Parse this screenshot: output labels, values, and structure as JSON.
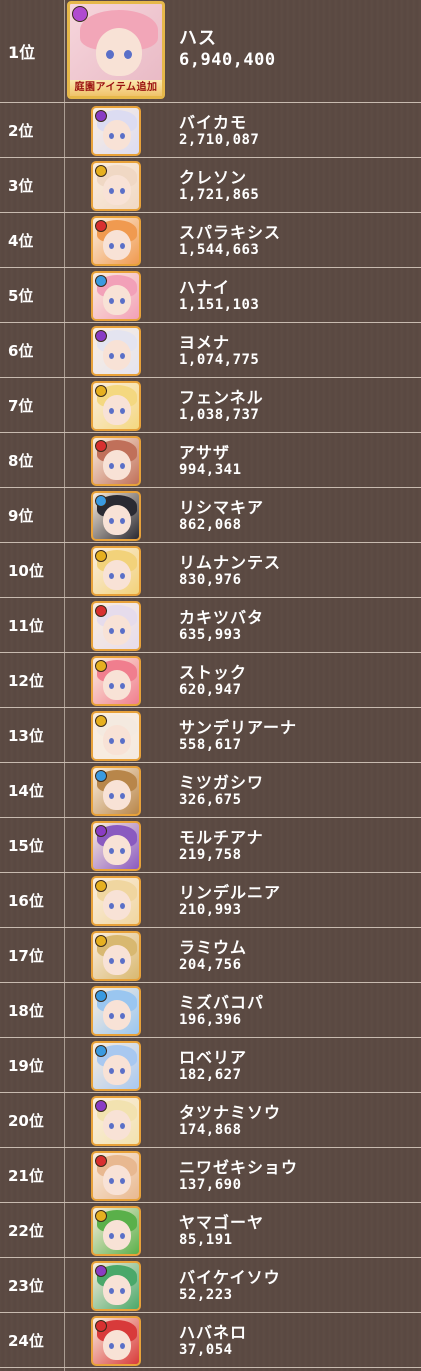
{
  "ranking": {
    "top": {
      "rank": "1位",
      "name": "ハス",
      "score": "6,940,400",
      "banner": "庭園アイテム追加",
      "hair": "#f2a6b8",
      "orb": "#b04ad0"
    },
    "rows": [
      {
        "rank": "2位",
        "name": "バイカモ",
        "score": "2,710,087",
        "hair": "#dcdcf2",
        "orb": "#8a3cc4",
        "icon": "character-portrait-icon"
      },
      {
        "rank": "3位",
        "name": "クレソン",
        "score": "1,721,865",
        "hair": "#f0d8c4",
        "orb": "#e6b020",
        "icon": "character-portrait-icon"
      },
      {
        "rank": "4位",
        "name": "スパラキシス",
        "score": "1,544,663",
        "hair": "#f09a50",
        "orb": "#d83030",
        "icon": "character-portrait-icon"
      },
      {
        "rank": "5位",
        "name": "ハナイ",
        "score": "1,151,103",
        "hair": "#f2a0b8",
        "orb": "#3a9ae0",
        "icon": "character-portrait-icon"
      },
      {
        "rank": "6位",
        "name": "ヨメナ",
        "score": "1,074,775",
        "hair": "#e4e4f0",
        "orb": "#8a3cc4",
        "icon": "character-portrait-icon"
      },
      {
        "rank": "7位",
        "name": "フェンネル",
        "score": "1,038,737",
        "hair": "#f4d880",
        "orb": "#e6b020",
        "icon": "character-portrait-icon"
      },
      {
        "rank": "8位",
        "name": "アサザ",
        "score": "994,341",
        "hair": "#c0705a",
        "orb": "#d83030",
        "icon": "character-portrait-icon"
      },
      {
        "rank": "9位",
        "name": "リシマキア",
        "score": "862,068",
        "hair": "#2a2a32",
        "orb": "#3a9ae0",
        "icon": "character-portrait-icon"
      },
      {
        "rank": "10位",
        "name": "リムナンテス",
        "score": "830,976",
        "hair": "#f2d27a",
        "orb": "#e6b020",
        "icon": "character-portrait-icon"
      },
      {
        "rank": "11位",
        "name": "カキツバタ",
        "score": "635,993",
        "hair": "#e6dcec",
        "orb": "#d83030",
        "icon": "character-portrait-icon"
      },
      {
        "rank": "12位",
        "name": "ストック",
        "score": "620,947",
        "hair": "#f07e8e",
        "orb": "#e6b020",
        "icon": "character-portrait-icon"
      },
      {
        "rank": "13位",
        "name": "サンデリアーナ",
        "score": "558,617",
        "hair": "#f4eae0",
        "orb": "#e6b020",
        "icon": "character-portrait-icon"
      },
      {
        "rank": "14位",
        "name": "ミツガシワ",
        "score": "326,675",
        "hair": "#b8864a",
        "orb": "#3a9ae0",
        "icon": "character-portrait-icon"
      },
      {
        "rank": "15位",
        "name": "モルチアナ",
        "score": "219,758",
        "hair": "#8a5ac0",
        "orb": "#8a3cc4",
        "icon": "character-portrait-icon"
      },
      {
        "rank": "16位",
        "name": "リンデルニア",
        "score": "210,993",
        "hair": "#f0d6a0",
        "orb": "#e6b020",
        "icon": "character-portrait-icon"
      },
      {
        "rank": "17位",
        "name": "ラミウム",
        "score": "204,756",
        "hair": "#d8b870",
        "orb": "#e6b020",
        "icon": "character-portrait-icon"
      },
      {
        "rank": "18位",
        "name": "ミズバコパ",
        "score": "196,396",
        "hair": "#9ac6f0",
        "orb": "#3a9ae0",
        "icon": "character-portrait-icon"
      },
      {
        "rank": "19位",
        "name": "ロベリア",
        "score": "182,627",
        "hair": "#a8c8f0",
        "orb": "#3a9ae0",
        "icon": "character-portrait-icon"
      },
      {
        "rank": "20位",
        "name": "タツナミソウ",
        "score": "174,868",
        "hair": "#f2e2b0",
        "orb": "#8a3cc4",
        "icon": "character-portrait-icon"
      },
      {
        "rank": "21位",
        "name": "ニワゼキショウ",
        "score": "137,690",
        "hair": "#e8b890",
        "orb": "#d83030",
        "icon": "character-portrait-icon"
      },
      {
        "rank": "22位",
        "name": "ヤマゴーヤ",
        "score": "85,191",
        "hair": "#5ab04a",
        "orb": "#e6b020",
        "icon": "character-portrait-icon"
      },
      {
        "rank": "23位",
        "name": "バイケイソウ",
        "score": "52,223",
        "hair": "#4aa86a",
        "orb": "#8a3cc4",
        "icon": "character-portrait-icon"
      },
      {
        "rank": "24位",
        "name": "ハバネロ",
        "score": "37,054",
        "hair": "#d83a3a",
        "orb": "#d83030",
        "icon": "character-portrait-icon"
      }
    ]
  }
}
